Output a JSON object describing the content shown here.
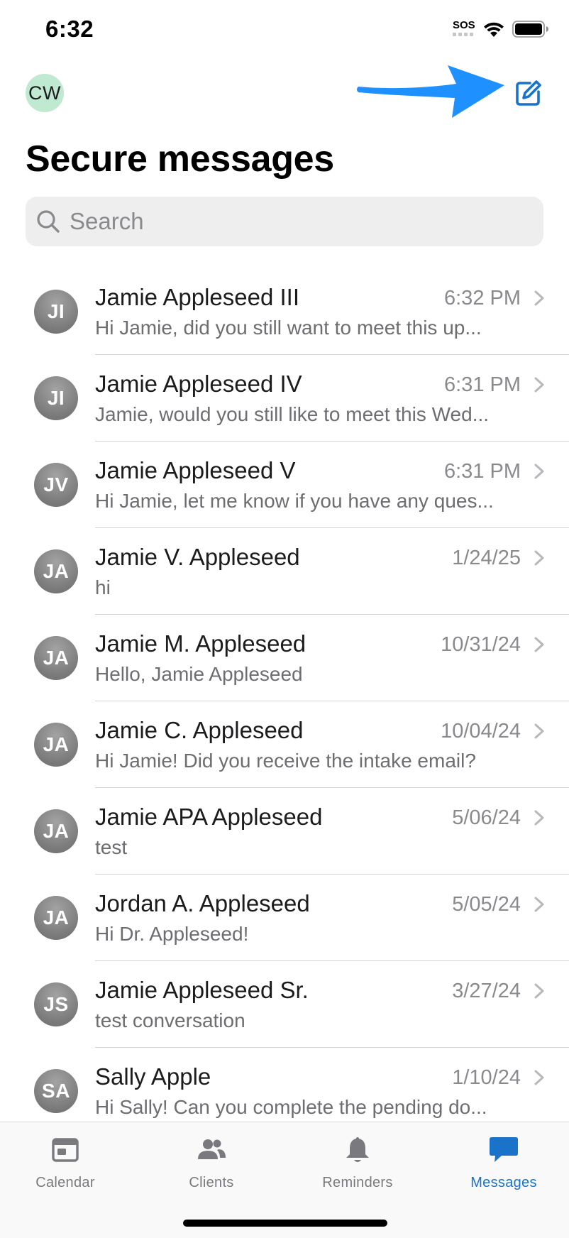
{
  "status_bar": {
    "time": "6:32",
    "sos": "SOS",
    "wifi_icon": "wifi-icon",
    "battery_icon": "battery-icon"
  },
  "header": {
    "user_initials": "CW",
    "compose_icon": "compose-icon",
    "annotation": "arrow pointing to compose button"
  },
  "title": "Secure messages",
  "search": {
    "placeholder": "Search",
    "value": ""
  },
  "conversations": [
    {
      "initials": "JI",
      "name": "Jamie Appleseed III",
      "date": "6:32 PM",
      "preview": "Hi Jamie, did you still want to meet this up..."
    },
    {
      "initials": "JI",
      "name": "Jamie Appleseed IV",
      "date": "6:31 PM",
      "preview": "Jamie, would you still like to meet this Wed..."
    },
    {
      "initials": "JV",
      "name": "Jamie Appleseed V",
      "date": "6:31 PM",
      "preview": "Hi Jamie, let me know if you have any ques..."
    },
    {
      "initials": "JA",
      "name": "Jamie V. Appleseed",
      "date": "1/24/25",
      "preview": "hi"
    },
    {
      "initials": "JA",
      "name": "Jamie M. Appleseed",
      "date": "10/31/24",
      "preview": "Hello, Jamie Appleseed"
    },
    {
      "initials": "JA",
      "name": "Jamie C. Appleseed",
      "date": "10/04/24",
      "preview": "Hi Jamie! Did you receive the intake email?"
    },
    {
      "initials": "JA",
      "name": "Jamie APA Appleseed",
      "date": "5/06/24",
      "preview": "test"
    },
    {
      "initials": "JA",
      "name": "Jordan A. Appleseed",
      "date": "5/05/24",
      "preview": "Hi Dr. Appleseed!"
    },
    {
      "initials": "JS",
      "name": "Jamie Appleseed Sr.",
      "date": "3/27/24",
      "preview": "test conversation"
    },
    {
      "initials": "SA",
      "name": "Sally Apple",
      "date": "1/10/24",
      "preview": "Hi Sally! Can you complete the pending do..."
    }
  ],
  "tabs": [
    {
      "label": "Calendar",
      "icon": "calendar-icon",
      "active": false
    },
    {
      "label": "Clients",
      "icon": "clients-icon",
      "active": false
    },
    {
      "label": "Reminders",
      "icon": "bell-icon",
      "active": false
    },
    {
      "label": "Messages",
      "icon": "messages-icon",
      "active": true
    }
  ],
  "colors": {
    "accent": "#1a73c8",
    "annotation_arrow": "#1e90ff",
    "avatar_me_bg": "#bfe9d1",
    "search_bg": "#eeeeef"
  }
}
